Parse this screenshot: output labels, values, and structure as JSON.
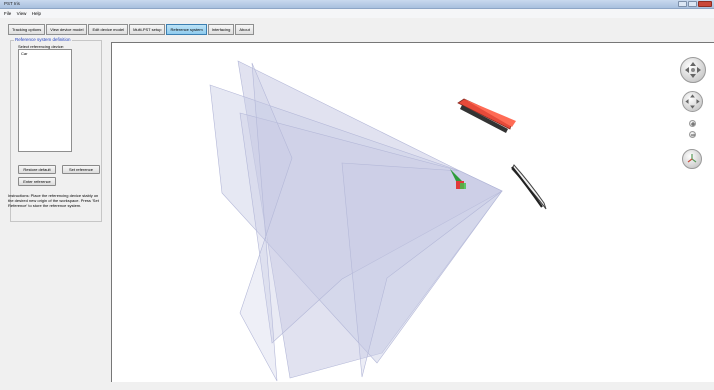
{
  "window": {
    "title": "PST Iris"
  },
  "menu": {
    "items": [
      "File",
      "View",
      "Help"
    ]
  },
  "tabs": [
    "Tracking options",
    "View device model",
    "Edit device model",
    "Multi-PST setup",
    "Reference system",
    "Interfacing",
    "About"
  ],
  "active_tab_index": 4,
  "panel": {
    "group_title": "Reference system definition",
    "select_label": "Select referencing device:",
    "list_items": [
      "Car"
    ],
    "restore_default_label": "Restore default",
    "set_reference_label": "Set reference",
    "enter_reference_label": "Enter reference",
    "instructions": "Instructions: Place the referencing device stably on the desired new origin of the workspace. Press 'Set Reference' to store the reference system."
  },
  "colors": {
    "frustum_fill": "#c8cbe4",
    "tracker_red": "#e64a3a",
    "tab_active": "#9fd3f0",
    "group_title": "#1f3fbf"
  },
  "view_controls": {
    "icons": [
      "rotate-navigation-icon",
      "pan-navigation-icon",
      "zoom-in-icon",
      "zoom-out-icon",
      "reset-view-icon"
    ]
  }
}
